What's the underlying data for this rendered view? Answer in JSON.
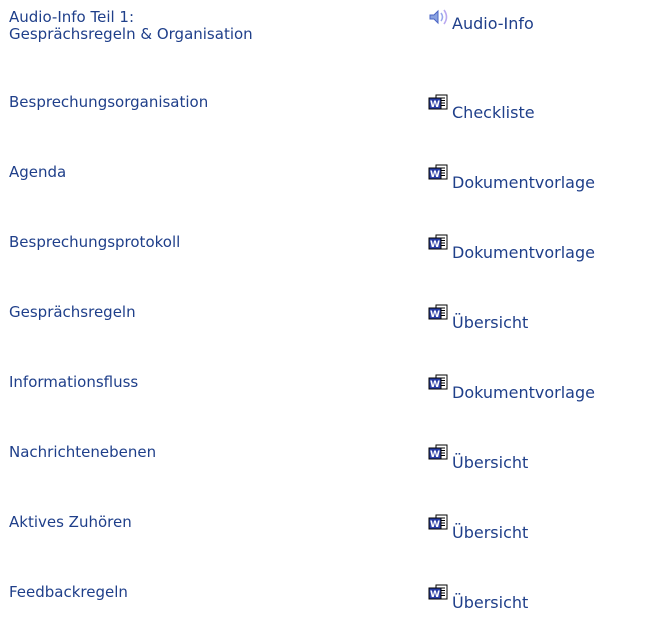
{
  "items": [
    {
      "title": "Audio-Info Teil 1:\nGesprächsregeln & Organisation",
      "link_label": "Audio-Info",
      "icon": "speaker-icon"
    },
    {
      "title": "Besprechungsorganisation",
      "link_label": "Checkliste",
      "icon": "word-document-icon"
    },
    {
      "title": "Agenda",
      "link_label": "Dokumentvorlage",
      "icon": "word-document-icon"
    },
    {
      "title": "Besprechungsprotokoll",
      "link_label": "Dokumentvorlage",
      "icon": "word-document-icon"
    },
    {
      "title": "Gesprächsregeln",
      "link_label": "Übersicht",
      "icon": "word-document-icon"
    },
    {
      "title": "Informationsfluss",
      "link_label": "Dokumentvorlage",
      "icon": "word-document-icon"
    },
    {
      "title": "Nachrichtenebenen",
      "link_label": "Übersicht",
      "icon": "word-document-icon"
    },
    {
      "title": "Aktives Zuhören",
      "link_label": "Übersicht",
      "icon": "word-document-icon"
    },
    {
      "title": "Feedbackregeln",
      "link_label": "Übersicht",
      "icon": "word-document-icon"
    }
  ],
  "colors": {
    "link": "#1f3f8a",
    "background": "#ffffff"
  }
}
